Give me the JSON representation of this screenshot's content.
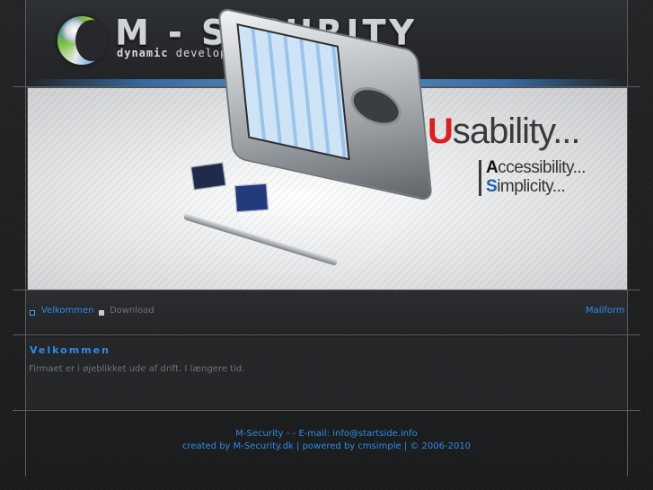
{
  "header": {
    "brand": "M - SECURITY",
    "tagline_bold": "dynamic",
    "tagline_rest": " development"
  },
  "banner": {
    "usability_cap": "U",
    "usability_rest": "sability...",
    "accessibility_cap": "A",
    "accessibility_rest": "ccessibility...",
    "simplicity_cap": "S",
    "simplicity_rest": "implicity..."
  },
  "nav": {
    "items": [
      {
        "label": "Velkommen"
      },
      {
        "label": "Download"
      }
    ],
    "mailform": "Mailform"
  },
  "content": {
    "title": "Velkommen",
    "text": "Firmaet er i øjeblikket ude af drift. I længere tid."
  },
  "footer": {
    "line1": "M-Security - - E-mail: info@startside.info",
    "line2": "created by M-Security.dk | powered by cmsimple | © 2006-2010"
  },
  "colors": {
    "accent": "#2f8ce8",
    "background": "#1b1c1e",
    "muted_text": "#6f7377"
  },
  "icons": [
    "logo-globe-icon",
    "nav-bullet-icon"
  ]
}
